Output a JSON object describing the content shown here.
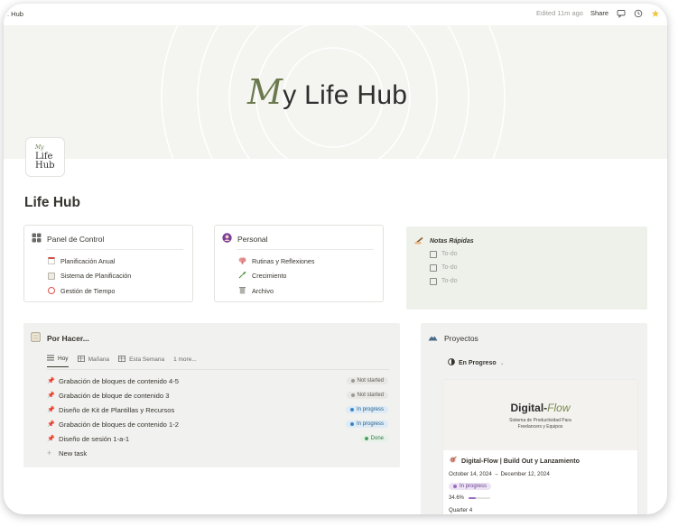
{
  "topbar": {
    "breadcrumb": ". Hub",
    "edited": "Edited 11m ago",
    "share": "Share"
  },
  "cover": {
    "title_initial": "M",
    "title_rest": "y Life Hub"
  },
  "page_icon": {
    "small": "My",
    "line1": "Life",
    "line2": "Hub"
  },
  "page_title": "Life Hub",
  "panel_control": {
    "title": "Panel de Control",
    "items": [
      {
        "label": "Planificación Anual",
        "icon": "calendar-icon",
        "color": "#d44c47"
      },
      {
        "label": "Sistema de Planificación",
        "icon": "notepad-icon",
        "color": "#b8b3a6"
      },
      {
        "label": "Gestión de Tiempo",
        "icon": "alarm-clock-icon",
        "color": "#e0524a"
      }
    ]
  },
  "personal": {
    "title": "Personal",
    "items": [
      {
        "label": "Rutinas y Reflexiones",
        "icon": "brain-icon",
        "color": "#e08a8a"
      },
      {
        "label": "Crecimiento",
        "icon": "sprout-icon",
        "color": "#5aa04a"
      },
      {
        "label": "Archivo",
        "icon": "trash-icon",
        "color": "#8a8a86"
      }
    ]
  },
  "notes": {
    "title": "Notas Rápidas",
    "items": [
      "To-do",
      "To-do",
      "To-do"
    ]
  },
  "todo": {
    "title": "Por Hacer...",
    "tabs": [
      {
        "label": "Hoy",
        "active": true
      },
      {
        "label": "Mañana",
        "active": false
      },
      {
        "label": "Esta Semana",
        "active": false
      },
      {
        "label": "1 more...",
        "active": false
      }
    ],
    "tasks": [
      {
        "name": "Grabación de bloques de contenido 4-5",
        "status": "Not started",
        "kind": "ns"
      },
      {
        "name": "Grabación de bloque de contenido 3",
        "status": "Not started",
        "kind": "ns"
      },
      {
        "name": "Diseño de Kit de Plantillas y Recursos",
        "status": "In progress",
        "kind": "ip"
      },
      {
        "name": "Grabación de bloques de contenido 1-2",
        "status": "In progress",
        "kind": "ip"
      },
      {
        "name": "Diseño de sesión 1-a-1",
        "status": "Done",
        "kind": "dn"
      }
    ],
    "new_task": "New task"
  },
  "projects": {
    "title": "Proyectos",
    "filter": "En Progreso",
    "card": {
      "brand_a": "Digital-",
      "brand_b": "Flow",
      "subtitle_1": "Sistema de Productividad Para",
      "subtitle_2": "Freelancers y Equipos",
      "title": "Digital-Flow | Build Out y Lanzamiento",
      "dates": "October 14, 2024 → December 12, 2024",
      "status": "In progress",
      "progress_text": "34.6%",
      "progress": 0.346,
      "quarter": "Quarter 4"
    }
  }
}
